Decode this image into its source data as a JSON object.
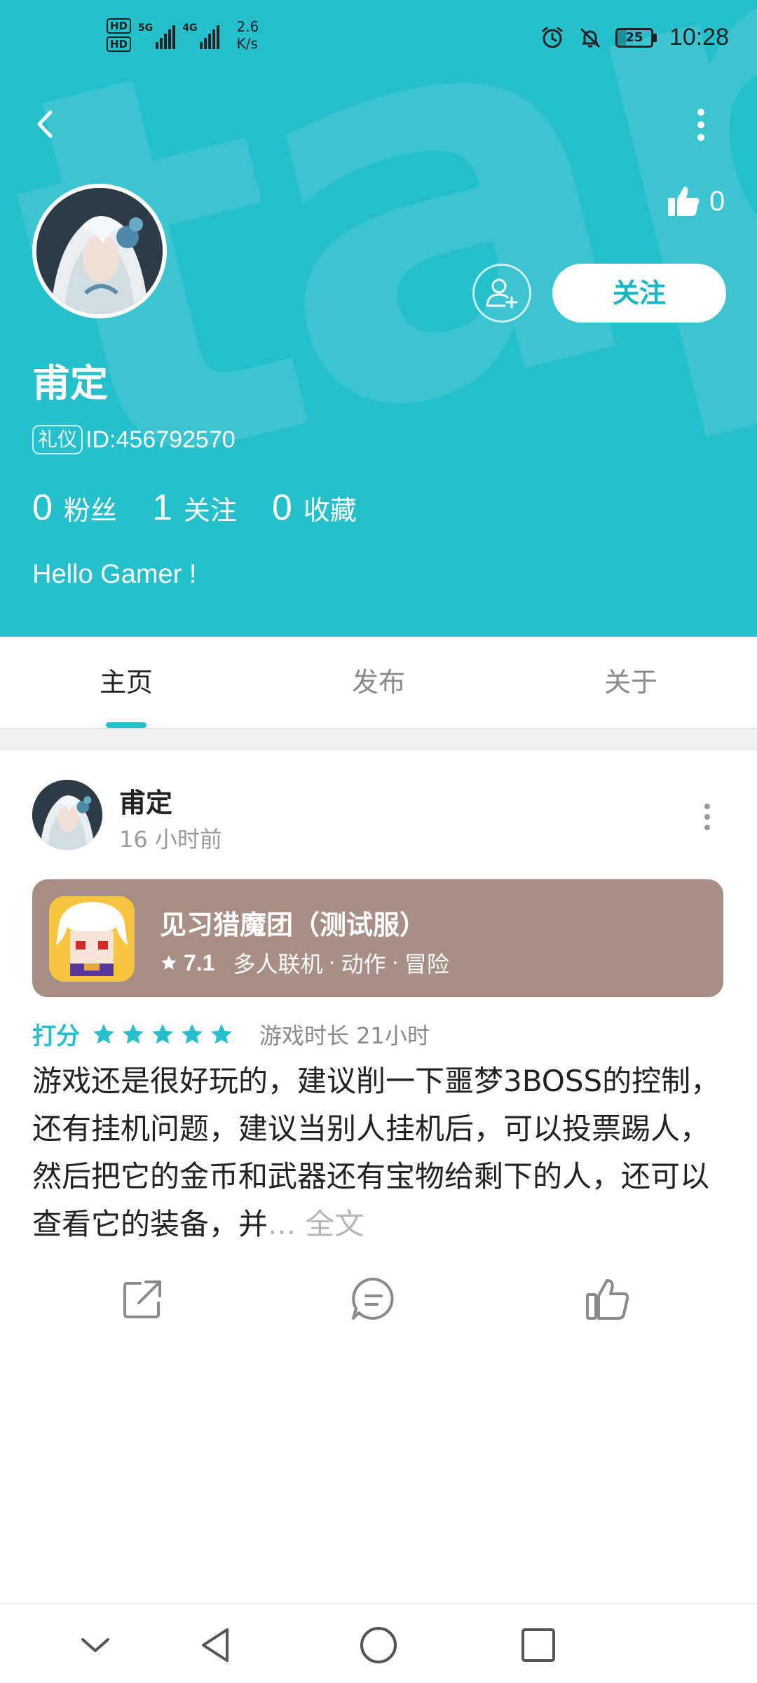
{
  "status_bar": {
    "hd_top": "HD",
    "hd_bottom": "HD",
    "net1": "5G",
    "net2": "4G",
    "speed_value": "2.6",
    "speed_unit": "K/s",
    "battery": "25",
    "time": "10:28"
  },
  "profile": {
    "watermark": "tapTap",
    "likes": "0",
    "follow_label": "关注",
    "name": "甫定",
    "badge": "礼仪",
    "id_text": "ID:456792570",
    "stats": [
      {
        "num": "0",
        "label": "粉丝"
      },
      {
        "num": "1",
        "label": "关注"
      },
      {
        "num": "0",
        "label": "收藏"
      }
    ],
    "bio": "Hello Gamer !"
  },
  "tabs": [
    {
      "label": "主页",
      "active": true
    },
    {
      "label": "发布",
      "active": false
    },
    {
      "label": "关于",
      "active": false
    }
  ],
  "post": {
    "author": "甫定",
    "time": "16 小时前",
    "game": {
      "title": "见习猎魔团（测试服）",
      "score": "7.1",
      "tags": [
        "多人联机",
        "动作",
        "冒险"
      ],
      "tag_separator": "·"
    },
    "rating_label": "打分",
    "stars": 5,
    "playtime": "游戏时长 21小时",
    "body": "游戏还是很好玩的，建议削一下噩梦3BOSS的控制，还有挂机问题，建议当别人挂机后，可以投票踢人，然后把它的金币和武器还有宝物给剩下的人，还可以查看它的装备，并",
    "ellipsis": "... ",
    "more_label": "全文"
  },
  "colors": {
    "accent": "#26bfcc",
    "game_card": "#a88f85",
    "star": "#26bfcc"
  },
  "icons": [
    "back-icon",
    "more-vertical-icon",
    "thumbs-up-icon",
    "add-user-icon",
    "star-icon",
    "share-icon",
    "comment-icon",
    "like-icon",
    "nav-down-icon",
    "nav-back-icon",
    "nav-home-icon",
    "nav-recents-icon"
  ]
}
